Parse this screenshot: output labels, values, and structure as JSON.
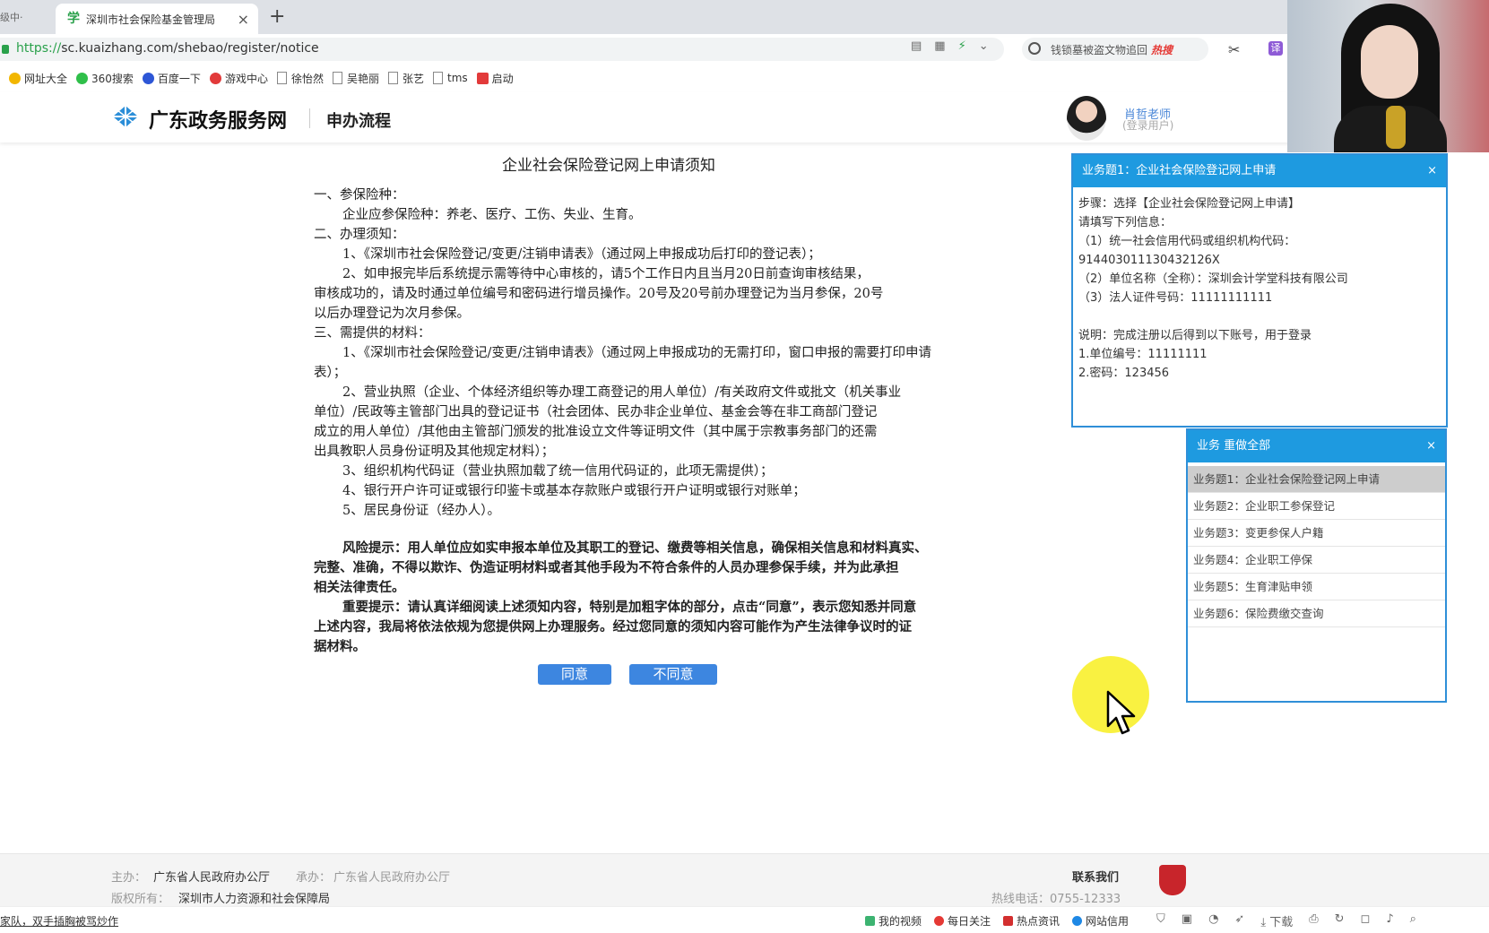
{
  "browser": {
    "prev_tab_label": "级中·",
    "active_tab": {
      "title": "深圳市社会保险基金管理局",
      "close": "×"
    },
    "new_tab": "+",
    "url_protocol": "https://",
    "url_rest": "sc.kuaizhang.com/shebao/register/notice",
    "search_text": "钱锁墓被盗文物追回",
    "search_badge": "热搜",
    "translate_label": "译",
    "bookmarks": [
      "网址大全",
      "360搜索",
      "百度一下",
      "游戏中心",
      "徐怡然",
      "吴艳丽",
      "张艺",
      "tms",
      "启动"
    ]
  },
  "site": {
    "logo_text": "广东政务服务网",
    "nav_label": "申办流程",
    "user_name": "肖哲老师",
    "user_role": "(登录用户)"
  },
  "notice": {
    "title": "企业社会保险登记网上申请须知",
    "lines": [
      "一、参保险种：",
      "企业应参保险种：养老、医疗、工伤、失业、生育。",
      "二、办理须知：",
      "1、《深圳市社会保险登记/变更/注销申请表》（通过网上申报成功后打印的登记表）；",
      "2、如申报完毕后系统提示需等待中心审核的，请5个工作日内且当月20日前查询审核结果，",
      "审核成功的，请及时通过单位编号和密码进行增员操作。20号及20号前办理登记为当月参保，20号",
      "以后办理登记为次月参保。",
      "三、需提供的材料：",
      "1、《深圳市社会保险登记/变更/注销申请表》（通过网上申报成功的无需打印，窗口申报的需要打印申请",
      "表）；",
      "2、营业执照（企业、个体经济组织等办理工商登记的用人单位）/有关政府文件或批文（机关事业",
      "单位）/民政等主管部门出具的登记证书（社会团体、民办非企业单位、基金会等在非工商部门登记",
      "成立的用人单位）/其他由主管部门颁发的批准设立文件等证明文件（其中属于宗教事务部门的还需",
      "出具教职人员身份证明及其他规定材料）；",
      "3、组织机构代码证（营业执照加载了统一信用代码证的，此项无需提供）；",
      "4、银行开户许可证或银行印鉴卡或基本存款账户或银行开户证明或银行对账单；",
      "5、居民身份证（经办人）。"
    ],
    "risk_lines": [
      "风险提示：用人单位应如实申报本单位及其职工的登记、缴费等相关信息，确保相关信息和材料真实、",
      "完整、准确，不得以欺诈、伪造证明材料或者其他手段为不符合条件的人员办理参保手续，并为此承担",
      "相关法律责任。"
    ],
    "important_lines": [
      "重要提示：请认真详细阅读上述须知内容，特别是加粗字体的部分，点击“同意”，表示您知悉并同意",
      "上述内容，我局将依法依规为您提供网上办理服务。经过您同意的须知内容可能作为产生法律争议时的证",
      "据材料。"
    ],
    "agree_label": "同意",
    "disagree_label": "不同意"
  },
  "task_panel": {
    "title": "业务题1：企业社会保险登记网上申请",
    "close": "×",
    "lines": [
      "步骤：选择【企业社会保险登记网上申请】",
      "请填写下列信息：",
      "（1）统一社会信用代码或组织机构代码：",
      "914403011130432126X",
      "（2）单位名称（全称）：深圳会计学堂科技有限公司",
      "（3）法人证件号码：11111111111",
      "",
      "说明：完成注册以后得到以下账号，用于登录",
      "1.单位编号：11111111",
      "2.密码：123456"
    ]
  },
  "task_list_panel": {
    "title": "业务  重做全部",
    "close": "×",
    "items": [
      "业务题1：企业社会保险登记网上申请",
      "业务题2：企业职工参保登记",
      "业务题3：变更参保人户籍",
      "业务题4：企业职工停保",
      "业务题5：生育津贴申领",
      "业务题6：保险费缴交查询"
    ]
  },
  "footer": {
    "host_label": "主办：",
    "host_value": "广东省人民政府办公厅",
    "co_label": "承办：",
    "co_value": "广东省人民政府办公厅",
    "copyright_label": "版权所有：",
    "copyright_value": "深圳市人力资源和社会保障局",
    "contact": "联系我们",
    "hotline": "热线电话：0755-12333"
  },
  "statusbar": {
    "news": "家队，双手插胸被骂炒作",
    "items": [
      "我的视频",
      "每日关注",
      "热点资讯",
      "网站信用"
    ],
    "download": "下载"
  },
  "colors": {
    "accent": "#1e9ae0",
    "button": "#3d86e0",
    "cursor_halo": "#f8ef2c"
  }
}
